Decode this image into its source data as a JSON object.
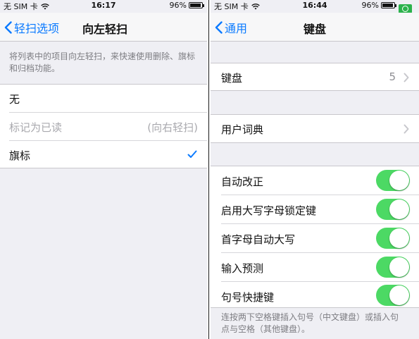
{
  "left": {
    "status": {
      "carrier": "无 SIM 卡",
      "time": "16:17",
      "battery": "96%"
    },
    "nav": {
      "back_label": "轻扫选项",
      "title": "向左轻扫"
    },
    "description": "将列表中的项目向左轻扫，来快速使用删除、旗标和归档功能。",
    "options": [
      {
        "label": "无",
        "detail": "",
        "selected": false,
        "disabled": false
      },
      {
        "label": "标记为已读",
        "detail": "(向右轻扫)",
        "selected": false,
        "disabled": true
      },
      {
        "label": "旗标",
        "detail": "",
        "selected": true,
        "disabled": false
      }
    ]
  },
  "right": {
    "status": {
      "carrier": "无 SIM 卡",
      "time": "16:44",
      "battery": "96%"
    },
    "nav": {
      "back_label": "通用",
      "title": "键盘"
    },
    "keyboards": {
      "label": "键盘",
      "value": "5"
    },
    "user_dictionary": {
      "label": "用户词典"
    },
    "toggles": [
      {
        "label": "自动改正",
        "on": true
      },
      {
        "label": "启用大写字母锁定键",
        "on": true
      },
      {
        "label": "首字母自动大写",
        "on": true
      },
      {
        "label": "输入预测",
        "on": true
      },
      {
        "label": "句号快捷键",
        "on": true
      }
    ],
    "footer_note": "连按两下空格键插入句号（中文键盘）或插入句点与空格（其他键盘）。"
  },
  "colors": {
    "accent": "#0a7aff",
    "toggle_on": "#4cd964",
    "background": "#efeff4"
  }
}
